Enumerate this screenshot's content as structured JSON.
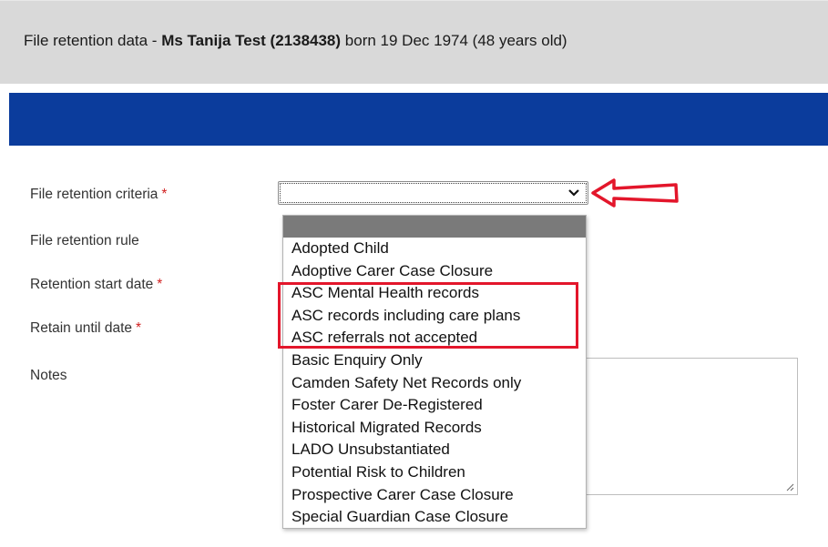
{
  "header": {
    "title_prefix": "File retention data - ",
    "title_name": "Ms Tanija Test (2138438)",
    "title_suffix": " born 19 Dec 1974 (48 years old)"
  },
  "form": {
    "criteria_label": "File retention criteria",
    "rule_label": "File retention rule",
    "start_date_label": "Retention start date",
    "until_date_label": "Retain until date",
    "notes_label": "Notes",
    "required_marker": "*",
    "criteria_value": ""
  },
  "dropdown": {
    "options": [
      "",
      "Adopted Child",
      "Adoptive Carer Case Closure",
      "ASC Mental Health records",
      "ASC records including care plans",
      "ASC referrals not accepted",
      "Basic Enquiry Only",
      "Camden Safety Net Records only",
      "Foster Carer De-Registered",
      "Historical Migrated Records",
      "LADO Unsubstantiated",
      "Potential Risk to Children",
      "Prospective Carer Case Closure",
      "Special Guardian Case Closure"
    ]
  },
  "colors": {
    "header_bg": "#d9d9d9",
    "blue_band": "#0b3c9c",
    "required": "#d11f1f",
    "annotation_red": "#e3162b",
    "selected_option_bg": "#7a7a7a"
  },
  "icons": {
    "select_chevron": "chevron-down-icon",
    "annotation_arrow": "arrow-left-icon",
    "resize_grip": "resize-grip-icon"
  }
}
